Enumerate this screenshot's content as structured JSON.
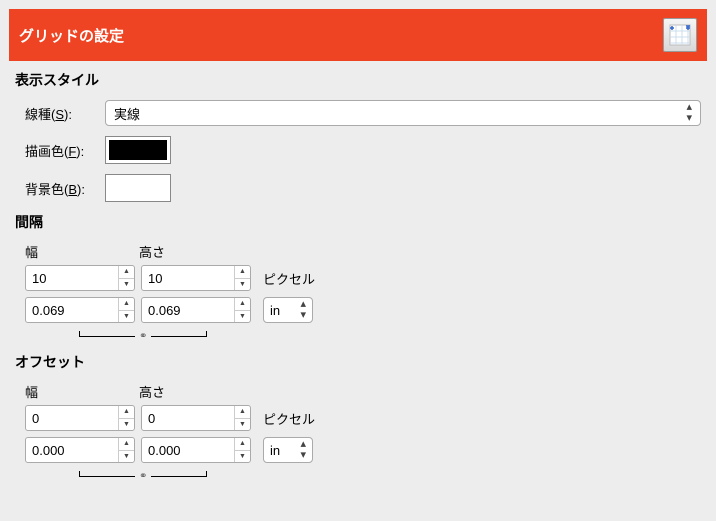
{
  "header": {
    "title": "グリッドの設定"
  },
  "display_style": {
    "section": "表示スタイル",
    "line_type_label_pre": "線種(",
    "line_type_label_key": "S",
    "line_type_label_post": "):",
    "line_type_value": "実線",
    "fg_label_pre": "描画色(",
    "fg_label_key": "F",
    "fg_label_post": "):",
    "bg_label_pre": "背景色(",
    "bg_label_key": "B",
    "bg_label_post": "):"
  },
  "spacing": {
    "section": "間隔",
    "width_label": "幅",
    "height_label": "高さ",
    "px_label": "ピクセル",
    "width_px": "10",
    "height_px": "10",
    "width_units": "0.069",
    "height_units": "0.069",
    "unit": "in"
  },
  "offset": {
    "section": "オフセット",
    "width_label": "幅",
    "height_label": "高さ",
    "px_label": "ピクセル",
    "width_px": "0",
    "height_px": "0",
    "width_units": "0.000",
    "height_units": "0.000",
    "unit": "in"
  }
}
